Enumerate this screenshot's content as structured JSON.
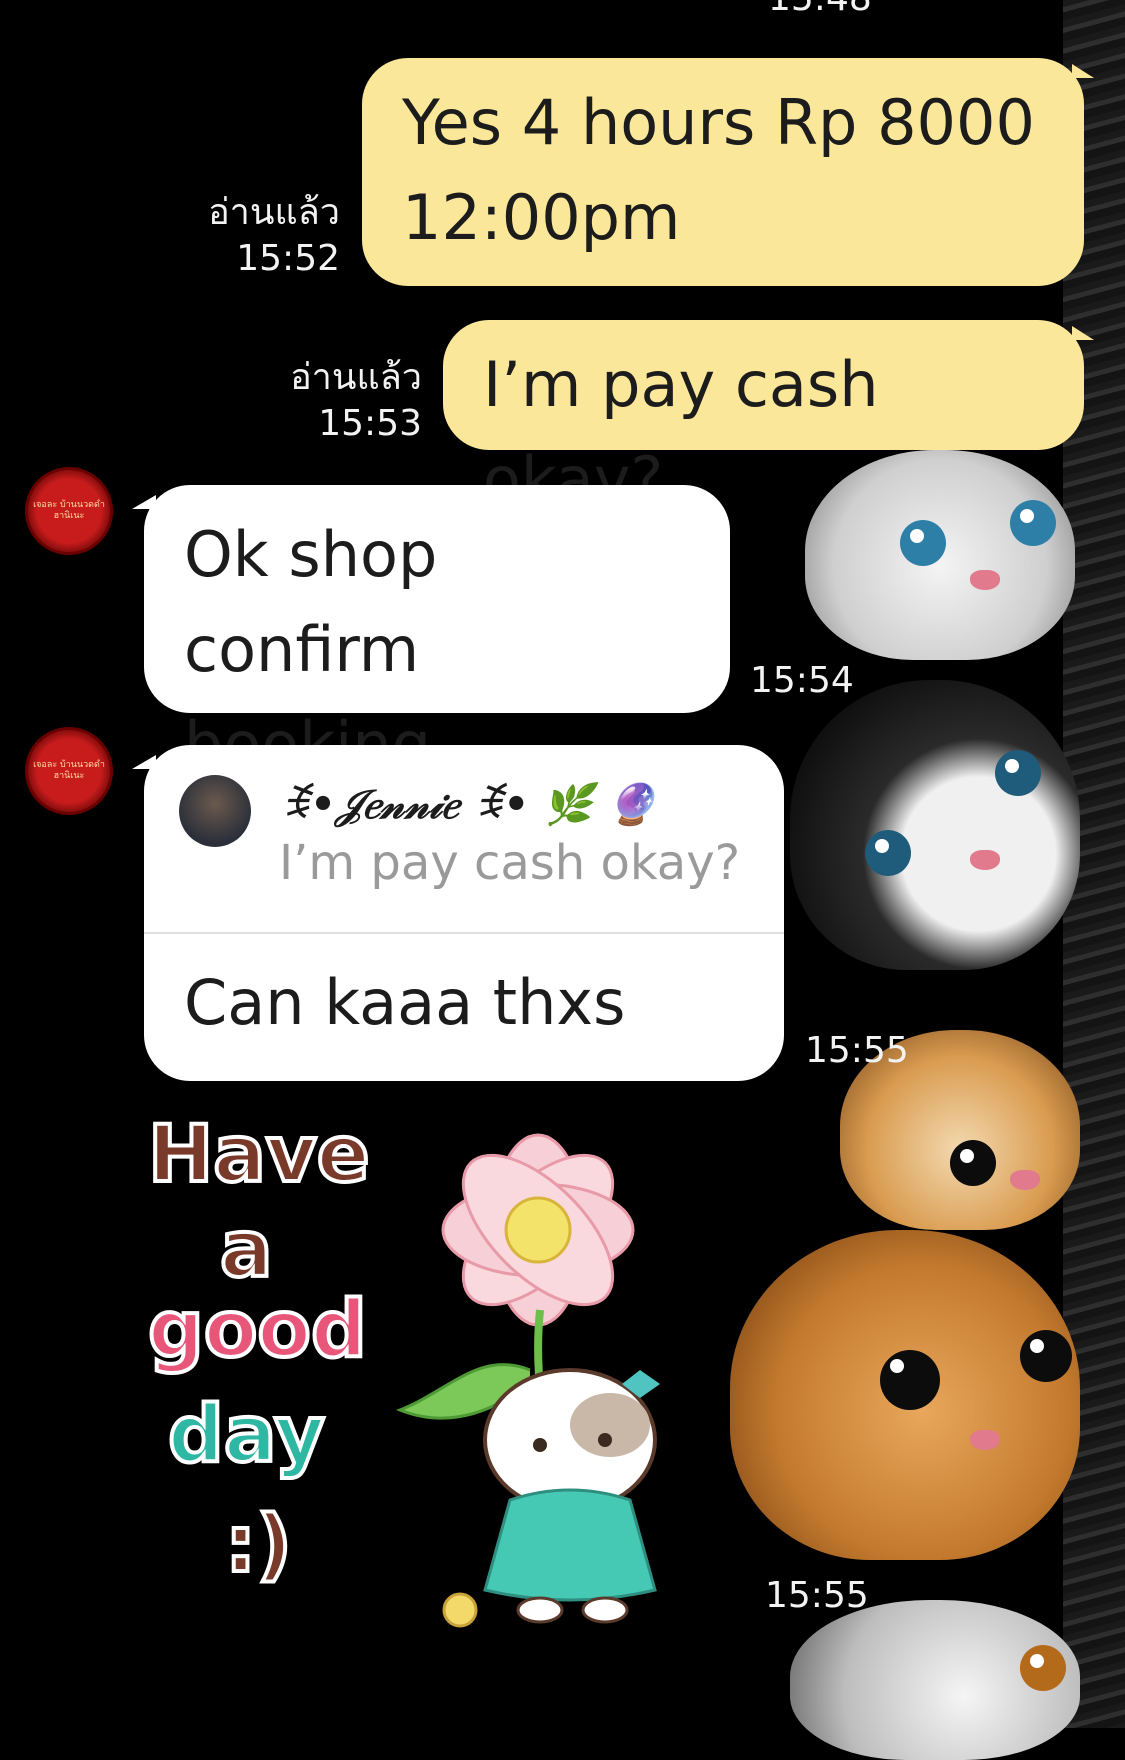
{
  "header": {
    "partial_time": "15:48"
  },
  "messages": [
    {
      "type": "outgoing",
      "text_lines": [
        "Yes 4 hours Rp 8000",
        "12:00pm"
      ],
      "read_label": "อ่านแล้ว",
      "time": "15:52"
    },
    {
      "type": "outgoing",
      "text_lines": [
        "I’m pay cash okay?"
      ],
      "read_label": "อ่านแล้ว",
      "time": "15:53"
    },
    {
      "type": "incoming",
      "text_lines": [
        "Ok shop confirm",
        "booking"
      ],
      "time": "15:54"
    },
    {
      "type": "incoming",
      "reply_to": {
        "author": "ꉂ•𝒥𝑒𝓃𝓃𝒾𝑒 ꉂ• 🌿 🔮",
        "quoted": "I’m pay cash okay?"
      },
      "text_lines": [
        "Can kaaa thxs"
      ],
      "time": "15:55"
    },
    {
      "type": "sticker",
      "words": [
        "Have",
        "a",
        "good",
        "day",
        ":)"
      ],
      "time": "15:55"
    }
  ],
  "avatar": {
    "text": "เจอละ บ้านนวดดำ ฮานิเนะ"
  },
  "colors": {
    "outgoing_bubble": "#fbe79a",
    "incoming_bubble": "#ffffff",
    "background": "#000000"
  }
}
